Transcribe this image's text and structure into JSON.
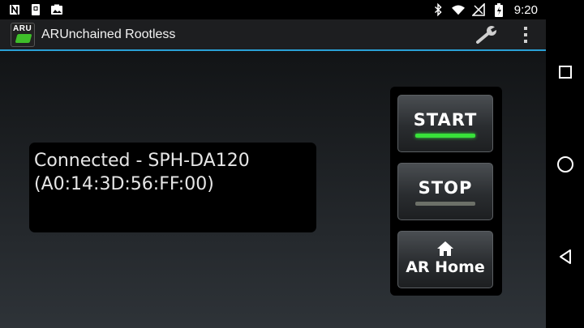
{
  "status_bar": {
    "left_icons": [
      "n-notification-icon",
      "sim-notification-icon",
      "image-notification-icon"
    ],
    "right_icons": [
      "bluetooth-icon",
      "wifi-icon",
      "no-signal-icon",
      "battery-icon"
    ],
    "time": "9:20"
  },
  "action_bar": {
    "app_icon_text": "ARU",
    "title": "ARUnchained Rootless",
    "actions": [
      "settings-wrench-icon",
      "overflow-menu-icon"
    ],
    "accent_color": "#2aa1d6"
  },
  "connection": {
    "status_line": "Connected - SPH-DA120",
    "address_line": "(A0:14:3D:56:FF:00)"
  },
  "controls": {
    "start_label": "START",
    "stop_label": "STOP",
    "home_label": "AR Home",
    "start_indicator_color": "#38e23a",
    "stop_indicator_color": "#6c7068"
  },
  "nav_bar": {
    "buttons": [
      "recent-apps",
      "home",
      "back"
    ]
  }
}
